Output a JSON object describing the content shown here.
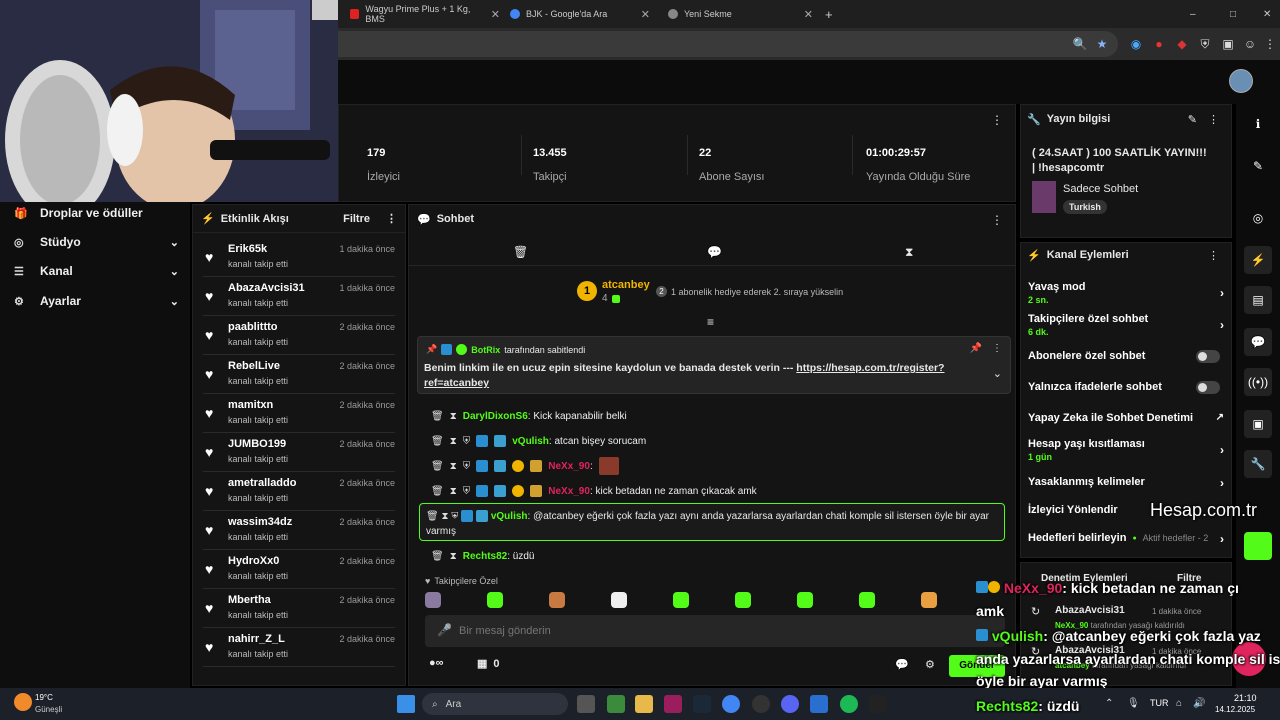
{
  "browser": {
    "tabs": [
      {
        "title": "Wagyu Prime Plus + 1 Kg, BMS",
        "favicon_color": "#d22"
      },
      {
        "title": "BJK - Google'da Ara",
        "favicon_color": "#4285f4"
      },
      {
        "title": "Yeni Sekme",
        "favicon_color": "#888"
      }
    ],
    "new_tab_symbol": "+",
    "window_controls": [
      "–",
      "□",
      "✕"
    ]
  },
  "stats": [
    {
      "value": "179",
      "label": "İzleyici"
    },
    {
      "value": "13.455",
      "label": "Takipçi"
    },
    {
      "value": "22",
      "label": "Abone Sayısı"
    },
    {
      "value": "01:00:29:57",
      "label": "Yayında Olduğu Süre"
    }
  ],
  "nav": {
    "items": [
      {
        "label": "Droplar ve ödüller",
        "icon": "gift-icon"
      },
      {
        "label": "Stüdyo",
        "icon": "studio-icon"
      },
      {
        "label": "Kanal",
        "icon": "channel-icon"
      },
      {
        "label": "Ayarlar",
        "icon": "gear-icon"
      }
    ]
  },
  "feed": {
    "title": "Etkinlik Akışı",
    "filter": "Filtre",
    "items": [
      {
        "name": "Erik65k",
        "action": "kanalı takip etti",
        "time": "1 dakika önce"
      },
      {
        "name": "AbazaAvcisi31",
        "action": "kanalı takip etti",
        "time": "1 dakika önce"
      },
      {
        "name": "paablittto",
        "action": "kanalı takip etti",
        "time": "2 dakika önce"
      },
      {
        "name": "RebelLive",
        "action": "kanalı takip etti",
        "time": "2 dakika önce"
      },
      {
        "name": "mamitxn",
        "action": "kanalı takip etti",
        "time": "2 dakika önce"
      },
      {
        "name": "JUMBO199",
        "action": "kanalı takip etti",
        "time": "2 dakika önce"
      },
      {
        "name": "ametralladdo",
        "action": "kanalı takip etti",
        "time": "2 dakika önce"
      },
      {
        "name": "wassim34dz",
        "action": "kanalı takip etti",
        "time": "2 dakika önce"
      },
      {
        "name": "HydroXx0",
        "action": "kanalı takip etti",
        "time": "2 dakika önce"
      },
      {
        "name": "Mbertha",
        "action": "kanalı takip etti",
        "time": "2 dakika önce"
      },
      {
        "name": "nahirr_Z_L",
        "action": "kanalı takip etti",
        "time": "2 dakika önce"
      }
    ]
  },
  "chat": {
    "title": "Sohbet",
    "top_gifter": {
      "name": "atcanbey",
      "rank": "1",
      "count": "4",
      "note": "1 abonelik hediye ederek 2. sıraya yükselin",
      "note_rank": "2"
    },
    "pinned": {
      "author": "BotRix",
      "suffix": "tarafından sabitlendi",
      "text": "Benim linkim ile en ucuz epin sitesine kaydolun ve banada destek verin --- ",
      "link": "https://hesap.com.tr/register?ref=atcanbey"
    },
    "messages": [
      {
        "user": "DarylDixonS6",
        "text": ": Kick kapanabilir belki",
        "color": "#53fc18"
      },
      {
        "user": "vQulish",
        "text": ": atcan bişey sorucam",
        "color": "#53fc18"
      },
      {
        "user": "NeXx_90",
        "text": ":",
        "color": "#e0245e"
      },
      {
        "user": "NeXx_90",
        "text": ": kick betadan ne zaman çıkacak amk",
        "color": "#e0245e"
      },
      {
        "user": "vQulish",
        "text": ": @atcanbey eğerki çok fazla yazı aynı anda yazarlarsa ayarlardan chati komple sil istersen öyle bir ayar varmış",
        "color": "#53fc18"
      },
      {
        "user": "Rechts82",
        "text": ": üzdü",
        "color": "#53fc18"
      }
    ],
    "emote_section": "Takipçilere Özel",
    "input_placeholder": "Bir mesaj gönderin",
    "points": "0",
    "send_label": "Gönder"
  },
  "stream_info": {
    "title": "Yayın bilgisi",
    "stream_title": "( 24.SAAT ) 100 SAATLİK YAYIN!!! | !hesapcomtr",
    "category": "Sadece Sohbet",
    "tag": "Turkish"
  },
  "channel_actions": {
    "title": "Kanal Eylemleri",
    "items": [
      {
        "label": "Yavaş mod",
        "sub": "2 sn."
      },
      {
        "label": "Takipçilere özel sohbet",
        "sub": "6 dk."
      },
      {
        "label": "Abonelere özel sohbet",
        "sub": ""
      },
      {
        "label": "Yalnızca ifadelerle sohbet",
        "sub": ""
      },
      {
        "label": "Yapay Zeka ile Sohbet Denetimi",
        "sub": ""
      },
      {
        "label": "Hesap yaşı kısıtlaması",
        "sub": "1 gün"
      },
      {
        "label": "Yasaklanmış kelimeler",
        "sub": ""
      },
      {
        "label": "İzleyici Yönlendir",
        "sub": ""
      },
      {
        "label": "Hedefleri belirleyin",
        "sub": "",
        "status": "Aktif hedefler - 2"
      }
    ]
  },
  "mod_log": {
    "title": "Denetim Eylemleri",
    "filter": "Filtre",
    "entries": [
      {
        "name": "AbazaAvcisi31",
        "time": "1 dakika önce",
        "detail_user": "NeXx_90",
        "detail": "tarafından yasağı kaldırıldı"
      },
      {
        "name": "AbazaAvcisi31",
        "time": "1 dakika önce",
        "detail_user": "atcanbey",
        "detail": "tarafından yasağı kaldırıldı"
      }
    ]
  },
  "overlay": {
    "brand": "Hesap.com.tr",
    "lines": [
      {
        "user": "NeXx_90",
        "text": ": kick betadan ne zaman çı"
      },
      {
        "user": "",
        "text": "amk"
      },
      {
        "user": "vQulish",
        "text": ": @atcanbey eğerki çok fazla yaz"
      },
      {
        "user": "",
        "text": "anda yazarlarsa ayarlardan chati komple sil is"
      },
      {
        "user": "",
        "text": "öyle bir ayar varmış"
      },
      {
        "user": "Rechts82",
        "text": ": üzdü"
      }
    ]
  },
  "taskbar": {
    "weather_temp": "19°C",
    "weather_desc": "Güneşli",
    "search": "Ara",
    "lang": "TUR",
    "time": "21:10",
    "date": "14.12.2025"
  },
  "colors": {
    "accent": "#53fc18",
    "danger": "#e0245e",
    "bg": "#141414"
  }
}
